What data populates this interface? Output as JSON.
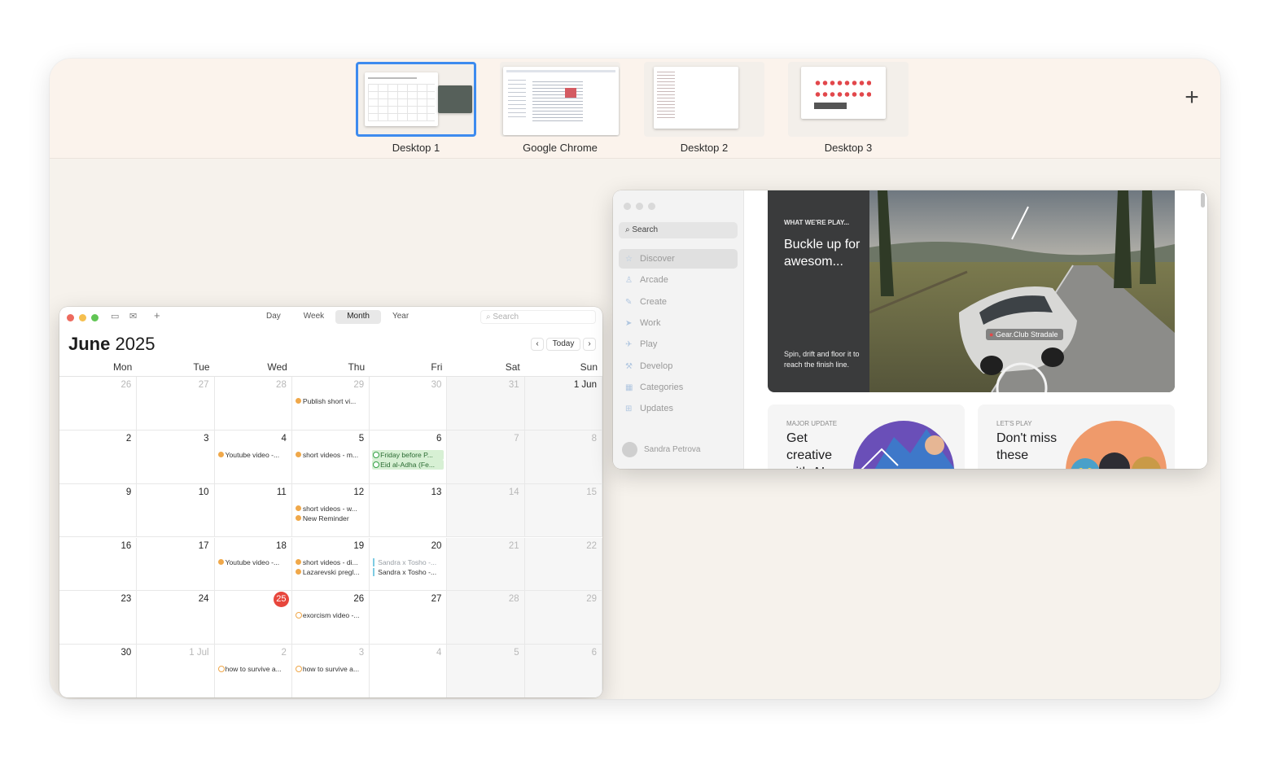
{
  "spaces": [
    {
      "label": "Desktop 1",
      "active": true
    },
    {
      "label": "Google Chrome",
      "active": false
    },
    {
      "label": "Desktop 2",
      "active": false
    },
    {
      "label": "Desktop 3",
      "active": false
    }
  ],
  "spaces_add": "+",
  "calendar": {
    "views": [
      "Day",
      "Week",
      "Month",
      "Year"
    ],
    "active_view": "Month",
    "search_placeholder": "Search",
    "month": "June",
    "year": "2025",
    "today_label": "Today",
    "prev": "‹",
    "next": "›",
    "weekdays": [
      "Mon",
      "Tue",
      "Wed",
      "Thu",
      "Fri",
      "Sat",
      "Sun"
    ],
    "weeks": [
      [
        {
          "d": "26",
          "dim": true
        },
        {
          "d": "27",
          "dim": true
        },
        {
          "d": "28",
          "dim": true
        },
        {
          "d": "29",
          "dim": true,
          "events": [
            {
              "t": "Publish short vi...",
              "k": "dot"
            }
          ]
        },
        {
          "d": "30",
          "dim": true
        },
        {
          "d": "31",
          "dim": true
        },
        {
          "d": "1 Jun"
        }
      ],
      [
        {
          "d": "2"
        },
        {
          "d": "3"
        },
        {
          "d": "4",
          "events": [
            {
              "t": "Youtube video -...",
              "k": "dot"
            }
          ]
        },
        {
          "d": "5",
          "events": [
            {
              "t": "short videos - m...",
              "k": "dot"
            }
          ]
        },
        {
          "d": "6",
          "events": [
            {
              "t": "Friday before P...",
              "k": "green"
            },
            {
              "t": "Eid al-Adha (Fe...",
              "k": "green"
            }
          ]
        },
        {
          "d": "7",
          "dim": true
        },
        {
          "d": "8",
          "dim": true
        }
      ],
      [
        {
          "d": "9"
        },
        {
          "d": "10"
        },
        {
          "d": "11"
        },
        {
          "d": "12",
          "events": [
            {
              "t": "short videos - w...",
              "k": "dot"
            },
            {
              "t": "New Reminder",
              "k": "dot"
            }
          ]
        },
        {
          "d": "13"
        },
        {
          "d": "14",
          "dim": true
        },
        {
          "d": "15",
          "dim": true
        }
      ],
      [
        {
          "d": "16"
        },
        {
          "d": "17"
        },
        {
          "d": "18",
          "events": [
            {
              "t": "Youtube video -...",
              "k": "dot"
            }
          ]
        },
        {
          "d": "19",
          "events": [
            {
              "t": "short videos - di...",
              "k": "dot"
            },
            {
              "t": "Lazarevski pregl...",
              "k": "dot"
            }
          ]
        },
        {
          "d": "20",
          "events": [
            {
              "t": "Sandra x Tosho -...",
              "k": "bar"
            },
            {
              "t": "Sandra x Tosho -...",
              "k": "bar-dark"
            }
          ]
        },
        {
          "d": "21",
          "dim": true
        },
        {
          "d": "22",
          "dim": true
        }
      ],
      [
        {
          "d": "23"
        },
        {
          "d": "24"
        },
        {
          "d": "25",
          "today": true
        },
        {
          "d": "26",
          "events": [
            {
              "t": "exorcism video -...",
              "k": "ring"
            }
          ]
        },
        {
          "d": "27"
        },
        {
          "d": "28",
          "dim": true
        },
        {
          "d": "29",
          "dim": true
        }
      ],
      [
        {
          "d": "30"
        },
        {
          "d": "1 Jul",
          "dim": true
        },
        {
          "d": "2",
          "dim": true,
          "events": [
            {
              "t": "how to survive a...",
              "k": "ring"
            }
          ]
        },
        {
          "d": "3",
          "dim": true,
          "events": [
            {
              "t": "how to survive a...",
              "k": "ring"
            }
          ]
        },
        {
          "d": "4",
          "dim": true
        },
        {
          "d": "5",
          "dim": true
        },
        {
          "d": "6",
          "dim": true
        }
      ]
    ]
  },
  "appstore": {
    "search": "Search",
    "nav": [
      {
        "label": "Discover",
        "icon": "star-icon",
        "glyph": "☆"
      },
      {
        "label": "Arcade",
        "icon": "joystick-icon",
        "glyph": "♙"
      },
      {
        "label": "Create",
        "icon": "brush-icon",
        "glyph": "✎"
      },
      {
        "label": "Work",
        "icon": "paper-plane-icon",
        "glyph": "➤"
      },
      {
        "label": "Play",
        "icon": "rocket-icon",
        "glyph": "✈"
      },
      {
        "label": "Develop",
        "icon": "hammer-icon",
        "glyph": "⚒"
      },
      {
        "label": "Categories",
        "icon": "grid-icon",
        "glyph": "▦"
      },
      {
        "label": "Updates",
        "icon": "download-icon",
        "glyph": "⊞"
      }
    ],
    "active_nav": "Discover",
    "user": "Sandra Petrova",
    "hero": {
      "kicker": "WHAT WE'RE PLAY...",
      "title": "Buckle up for awesom...",
      "desc": "Spin, drift and floor it to reach the finish line.",
      "badge": "Gear.Club Stradale"
    },
    "cards": [
      {
        "kicker": "MAJOR UPDATE",
        "title": "Get creative with AI"
      },
      {
        "kicker": "LET'S PLAY",
        "title": "Don't miss these"
      }
    ]
  }
}
